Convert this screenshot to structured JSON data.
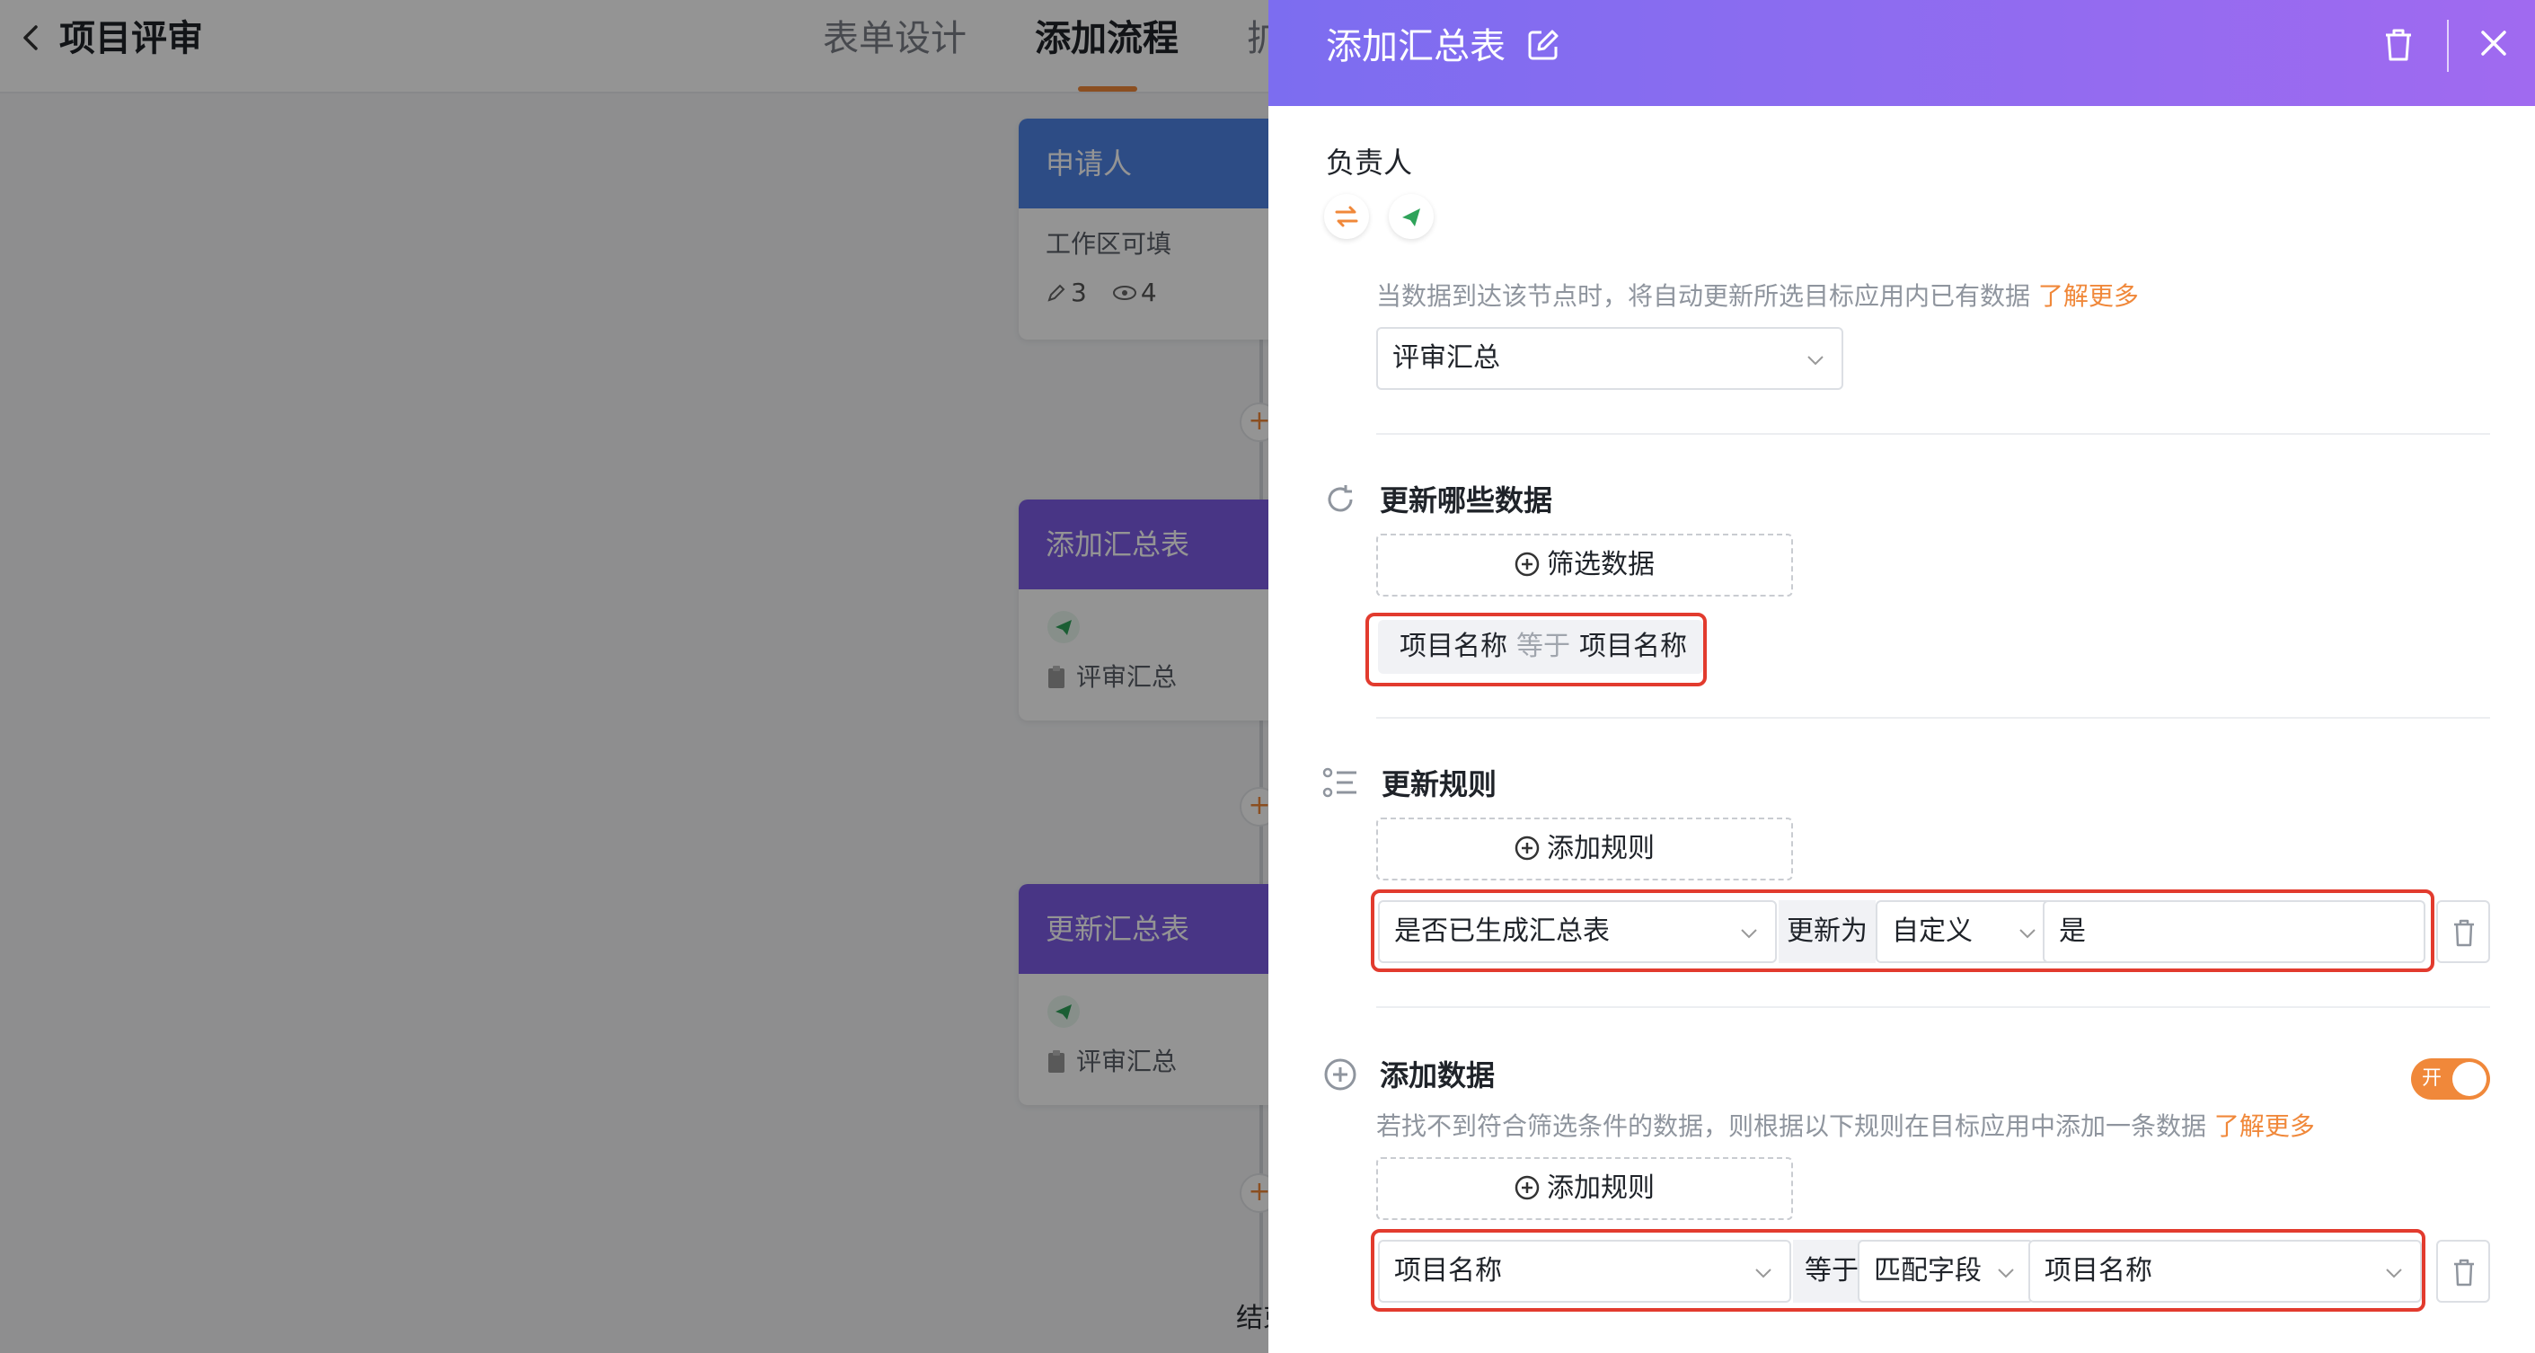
{
  "app": {
    "title": "项目评审",
    "tabs": [
      {
        "label": "表单设计"
      },
      {
        "label": "添加流程"
      },
      {
        "label": "扩"
      }
    ]
  },
  "flow": {
    "nodes": [
      {
        "title": "申请人",
        "desc": "工作区可填",
        "edit_count": "3",
        "view_count": "4"
      },
      {
        "title": "添加汇总表",
        "target": "评审汇总"
      },
      {
        "title": "更新汇总表",
        "target": "评审汇总"
      }
    ],
    "add_symbol": "+",
    "end_label": "结束"
  },
  "drawer": {
    "title": "添加汇总表",
    "owner_label": "负责人",
    "target_hint": "当数据到达该节点时，将自动更新所选目标应用内已有数据",
    "learn_more": "了解更多",
    "target_app": "评审汇总",
    "update_which": {
      "title": "更新哪些数据",
      "filter_button": "筛选数据",
      "condition": {
        "field": "项目名称",
        "op": "等于",
        "value": "项目名称"
      }
    },
    "update_rules": {
      "title": "更新规则",
      "add_button": "添加规则",
      "rule": {
        "field": "是否已生成汇总表",
        "op": "更新为",
        "type": "自定义",
        "value": "是"
      }
    },
    "add_data": {
      "title": "添加数据",
      "toggle_label": "开",
      "toggle_on": true,
      "hint": "若找不到符合筛选条件的数据，则根据以下规则在目标应用中添加一条数据",
      "learn_more": "了解更多",
      "add_button": "添加规则",
      "rule": {
        "field": "项目名称",
        "op": "等于",
        "type": "匹配字段",
        "value": "项目名称"
      }
    }
  },
  "colors": {
    "accent": "#f0883a",
    "header_start": "#7c6df0",
    "header_end": "#a06af0",
    "highlight": "#e23b2e",
    "node_blue": "#4f83e6",
    "node_purple": "#7c5ce6"
  }
}
